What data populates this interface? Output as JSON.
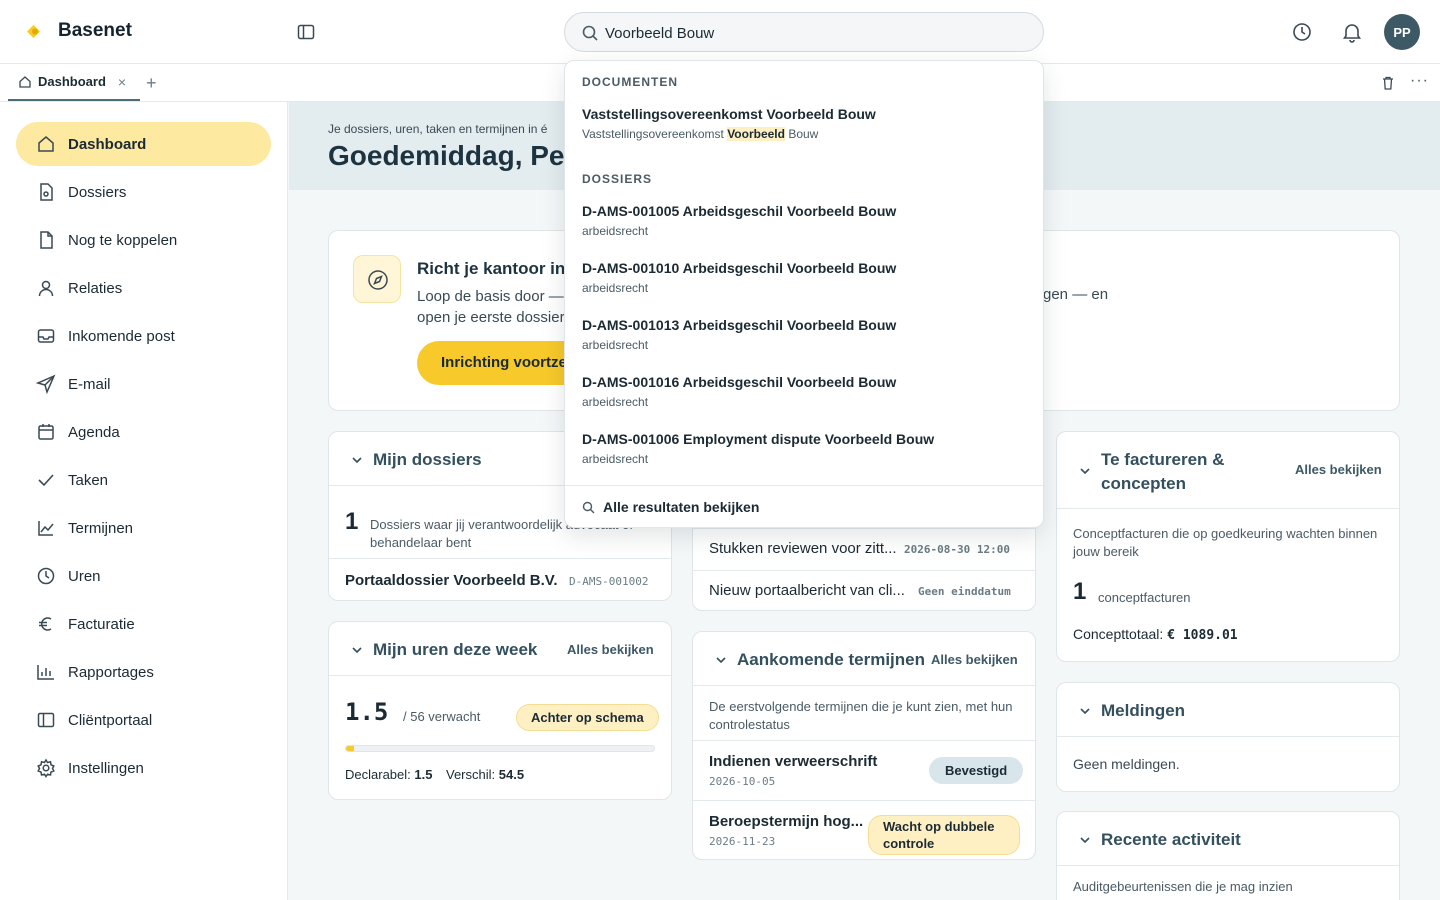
{
  "brand": {
    "name": "Basenet",
    "accent": "#f7c92a"
  },
  "search": {
    "value": "Voorbeeld Bouw"
  },
  "user": {
    "initials": "PP"
  },
  "tabs": [
    {
      "label": "Dashboard",
      "close": "×"
    }
  ],
  "tab_add": "+",
  "tab_more": "···",
  "sidebar": {
    "items": [
      {
        "label": "Dashboard",
        "icon": "home-icon",
        "active": true
      },
      {
        "label": "Dossiers",
        "icon": "dossier-icon"
      },
      {
        "label": "Nog te koppelen",
        "icon": "file-icon"
      },
      {
        "label": "Relaties",
        "icon": "user-icon"
      },
      {
        "label": "Inkomende post",
        "icon": "inbox-icon"
      },
      {
        "label": "E-mail",
        "icon": "send-icon"
      },
      {
        "label": "Agenda",
        "icon": "calendar-icon"
      },
      {
        "label": "Taken",
        "icon": "check-icon"
      },
      {
        "label": "Termijnen",
        "icon": "chart-line-icon"
      },
      {
        "label": "Uren",
        "icon": "clock-icon"
      },
      {
        "label": "Facturatie",
        "icon": "euro-icon"
      },
      {
        "label": "Rapportages",
        "icon": "bar-chart-icon"
      },
      {
        "label": "Cliëntportaal",
        "icon": "portal-icon"
      },
      {
        "label": "Instellingen",
        "icon": "gear-icon"
      }
    ]
  },
  "hero": {
    "subtitle": "Je dossiers, uren, taken en termijnen in é",
    "title": "Goedemiddag, Pet"
  },
  "setup": {
    "title": "Richt je kantoor in",
    "text": "Loop de basis door — a",
    "text_line2": "open je eerste dossier.",
    "text_right": "gen — en",
    "button": "Inrichting voortzetten"
  },
  "my_dossiers": {
    "title": "Mijn dossiers",
    "count": "1",
    "count_label": "Dossiers waar jij verantwoordelijk advocaat of behandelaar bent",
    "row_name": "Portaaldossier Voorbeeld B.V.",
    "row_code": "D-AMS-001002"
  },
  "my_hours": {
    "title": "Mijn uren deze week",
    "link": "Alles bekijken",
    "value": "1.5",
    "expected": "/ 56 verwacht",
    "badge": "Achter op schema",
    "progress_fraction": 0.027,
    "declarable_label": "Declarabel:",
    "declarable_value": "1.5",
    "difference_label": "Verschil:",
    "difference_value": "54.5"
  },
  "tasks": [
    {
      "name": "Stukken reviewen voor zitt...",
      "due": "2026-08-30 12:00"
    },
    {
      "name": "Nieuw portaalbericht van cli...",
      "due": "Geen einddatum"
    }
  ],
  "deadlines": {
    "title": "Aankomende termijnen",
    "link": "Alles bekijken",
    "desc": "De eerstvolgende termijnen die je kunt zien, met hun controlestatus",
    "items": [
      {
        "name": "Indienen verweerschrift",
        "date": "2026-10-05",
        "status": "Bevestigd"
      },
      {
        "name": "Beroepstermijn hog...",
        "date": "2026-11-23",
        "status": "Wacht op dubbele controle"
      }
    ]
  },
  "invoicing": {
    "title": "Te factureren & concepten",
    "link": "Alles bekijken",
    "desc": "Conceptfacturen die op goedkeuring wachten binnen jouw bereik",
    "count": "1",
    "count_label": "conceptfacturen",
    "total_label": "Concepttotaal:",
    "total_value": "€ 1089.01"
  },
  "notifications": {
    "title": "Meldingen",
    "empty": "Geen meldingen."
  },
  "activity": {
    "title": "Recente activiteit",
    "desc": "Auditgebeurtenissen die je mag inzien"
  },
  "dropdown": {
    "documents_label": "DOCUMENTEN",
    "documents": [
      {
        "title": "Vaststellingsovereenkomst Voorbeeld Bouw",
        "sub_before": "Vaststellingsovereenkomst ",
        "sub_hl": "Voorbeeld",
        "sub_after": " Bouw"
      }
    ],
    "dossiers_label": "DOSSIERS",
    "dossiers": [
      {
        "title": "D-AMS-001005 Arbeidsgeschil Voorbeeld Bouw",
        "sub": "arbeidsrecht"
      },
      {
        "title": "D-AMS-001010 Arbeidsgeschil Voorbeeld Bouw",
        "sub": "arbeidsrecht"
      },
      {
        "title": "D-AMS-001013 Arbeidsgeschil Voorbeeld Bouw",
        "sub": "arbeidsrecht"
      },
      {
        "title": "D-AMS-001016 Arbeidsgeschil Voorbeeld Bouw",
        "sub": "arbeidsrecht"
      },
      {
        "title": "D-AMS-001006 Employment dispute Voorbeeld Bouw",
        "sub": "arbeidsrecht"
      }
    ],
    "all_results": "Alle resultaten bekijken"
  }
}
